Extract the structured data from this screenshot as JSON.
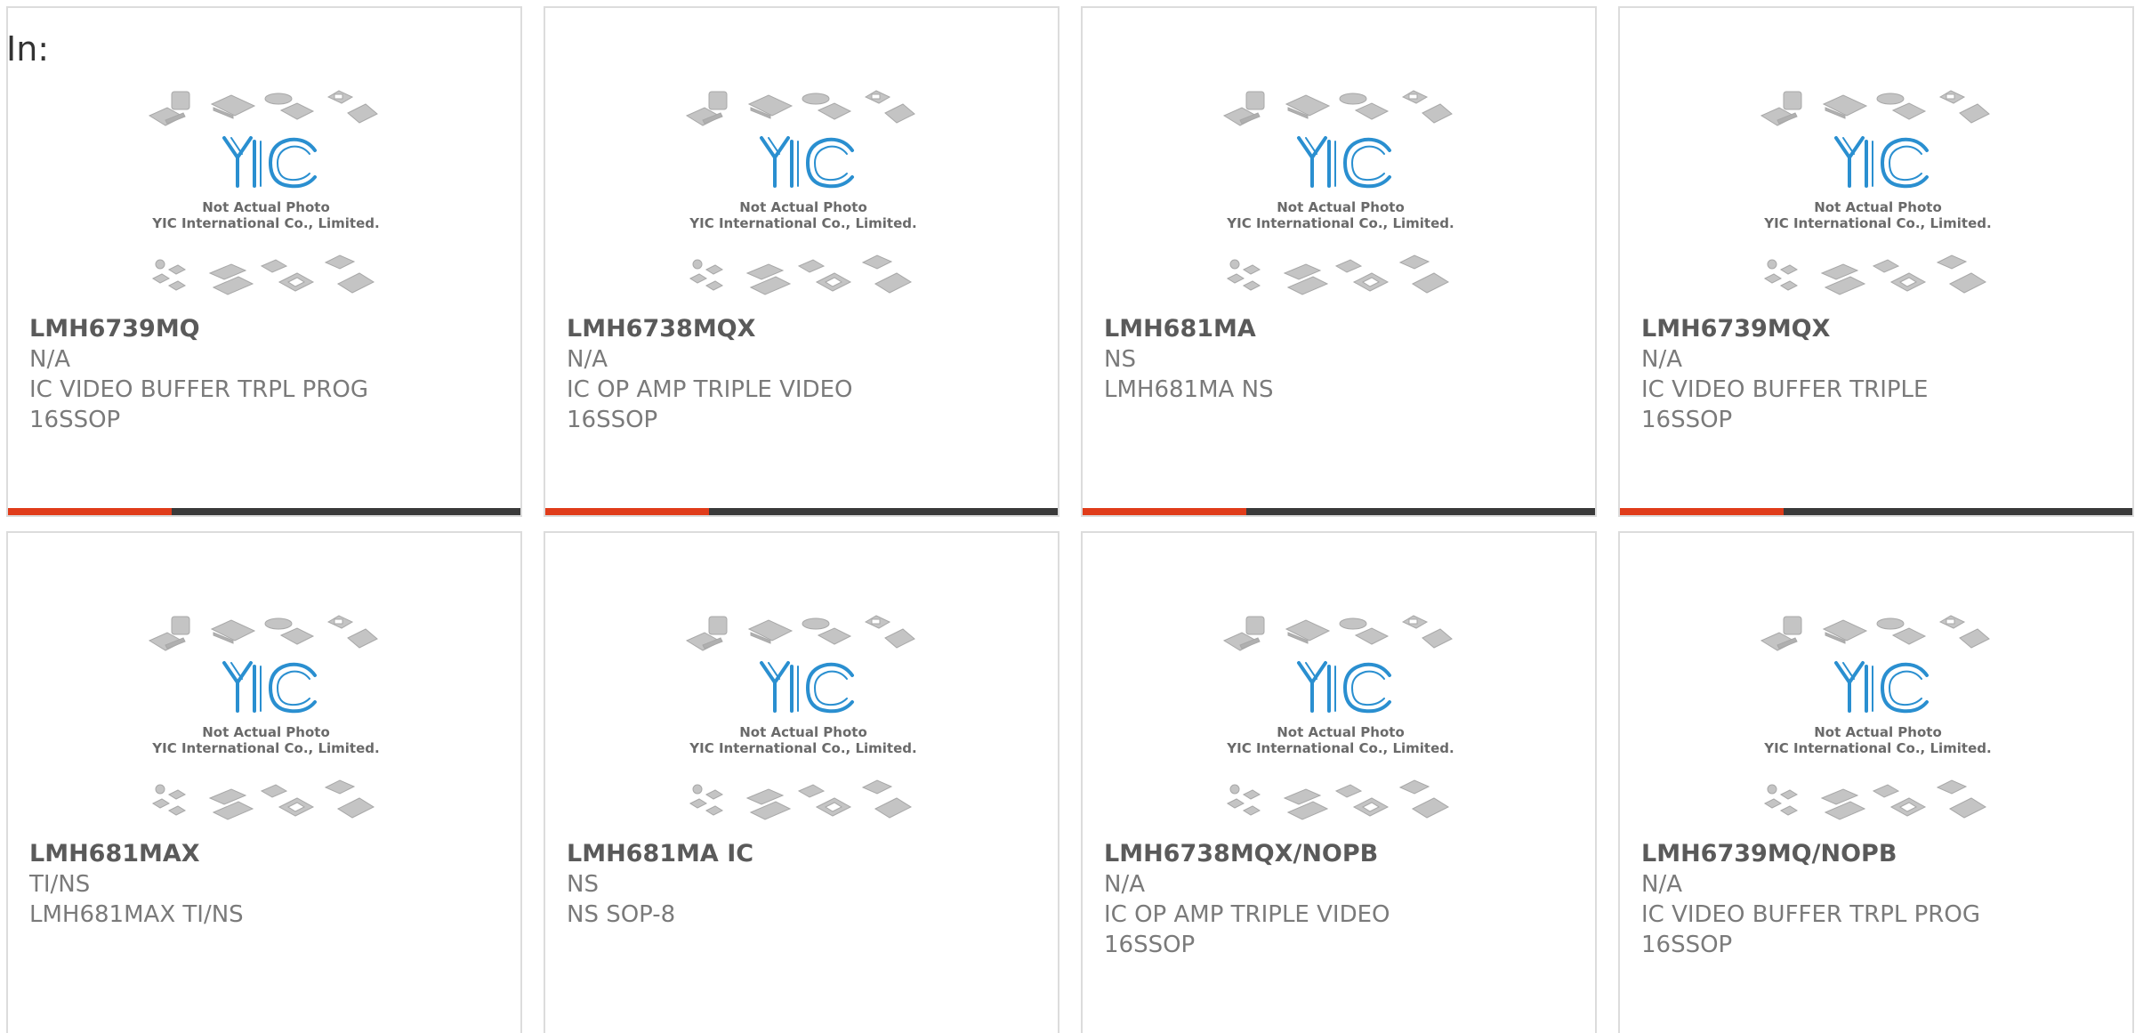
{
  "filter": {
    "label": "In:"
  },
  "placeholder_image": {
    "caption_line1": "Not Actual Photo",
    "caption_line2": "YIC International Co., Limited.",
    "logo_text": "YIC",
    "icon": "chip-package-icon"
  },
  "colors": {
    "accent": "#e03c1a",
    "bar_dark": "#3a3a3a",
    "logo_blue": "#2a8fd0",
    "text_title": "#5a5a5a",
    "text_body": "#7a7a7a",
    "border": "#dcdcdc"
  },
  "products": [
    {
      "part_number": "LMH6739MQ",
      "manufacturer": "N/A",
      "description": "IC VIDEO BUFFER TRPL PROG 16SSOP"
    },
    {
      "part_number": "LMH6738MQX",
      "manufacturer": "N/A",
      "description": "IC OP AMP TRIPLE VIDEO 16SSOP"
    },
    {
      "part_number": "LMH681MA",
      "manufacturer": "NS",
      "description": "LMH681MA NS"
    },
    {
      "part_number": "LMH6739MQX",
      "manufacturer": "N/A",
      "description": "IC VIDEO BUFFER TRIPLE 16SSOP"
    },
    {
      "part_number": "LMH681MAX",
      "manufacturer": "TI/NS",
      "description": "LMH681MAX TI/NS"
    },
    {
      "part_number": "LMH681MA IC",
      "manufacturer": "NS",
      "description": "NS SOP-8"
    },
    {
      "part_number": "LMH6738MQX/NOPB",
      "manufacturer": "N/A",
      "description": "IC OP AMP TRIPLE VIDEO 16SSOP"
    },
    {
      "part_number": "LMH6739MQ/NOPB",
      "manufacturer": "N/A",
      "description": "IC VIDEO BUFFER TRPL PROG 16SSOP"
    }
  ]
}
